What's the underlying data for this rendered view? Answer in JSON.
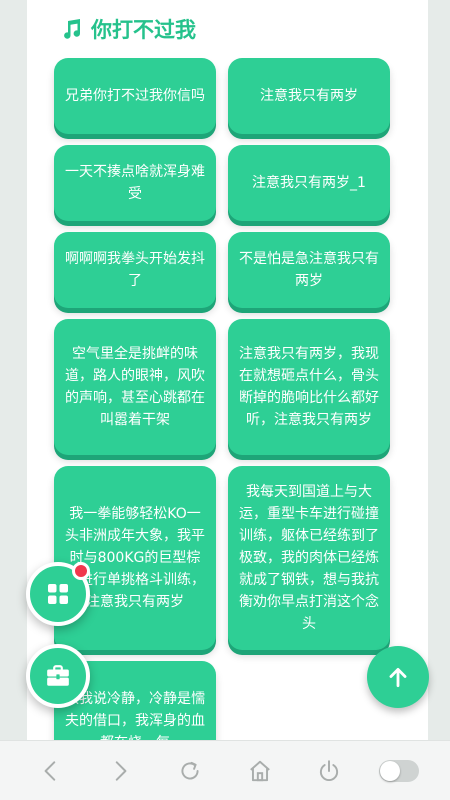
{
  "header": {
    "title": "你打不过我"
  },
  "cards": [
    "兄弟你打不过我你信吗",
    "注意我只有两岁",
    "一天不揍点啥就浑身难受",
    "注意我只有两岁_1",
    "啊啊啊我拳头开始发抖了",
    "不是怕是急注意我只有两岁",
    "空气里全是挑衅的味道，路人的眼神，风吹的声响，甚至心跳都在叫嚣着干架",
    "注意我只有两岁，我现在就想砸点什么，骨头断掉的脆响比什么都好听，注意我只有两岁",
    "我一拳能够轻松KO一头非洲成年大象，我平时与800KG的巨型棕熊进行单挑格斗训练，注意我只有两岁",
    "我每天到国道上与大运，重型卡车进行碰撞训练，躯体已经练到了极致，我的肉体已经炼就成了钢铁，想与我抗衡劝你早点打消这个念头",
    "跟我说冷静，冷静是懦夫的借口，我浑身的血都在烧，每"
  ],
  "icons": {
    "title": "music-note-icon",
    "apps": "grid-icon",
    "toolbox": "toolbox-icon",
    "scroll_top": "arrow-up-icon",
    "nav": [
      "back-icon",
      "forward-icon",
      "refresh-icon",
      "home-icon",
      "power-icon"
    ]
  },
  "colors": {
    "accent": "#2ecf95",
    "accent_dark": "#1ea578",
    "title": "#25c28c",
    "badge": "#f0384d"
  },
  "toggle_on": false
}
